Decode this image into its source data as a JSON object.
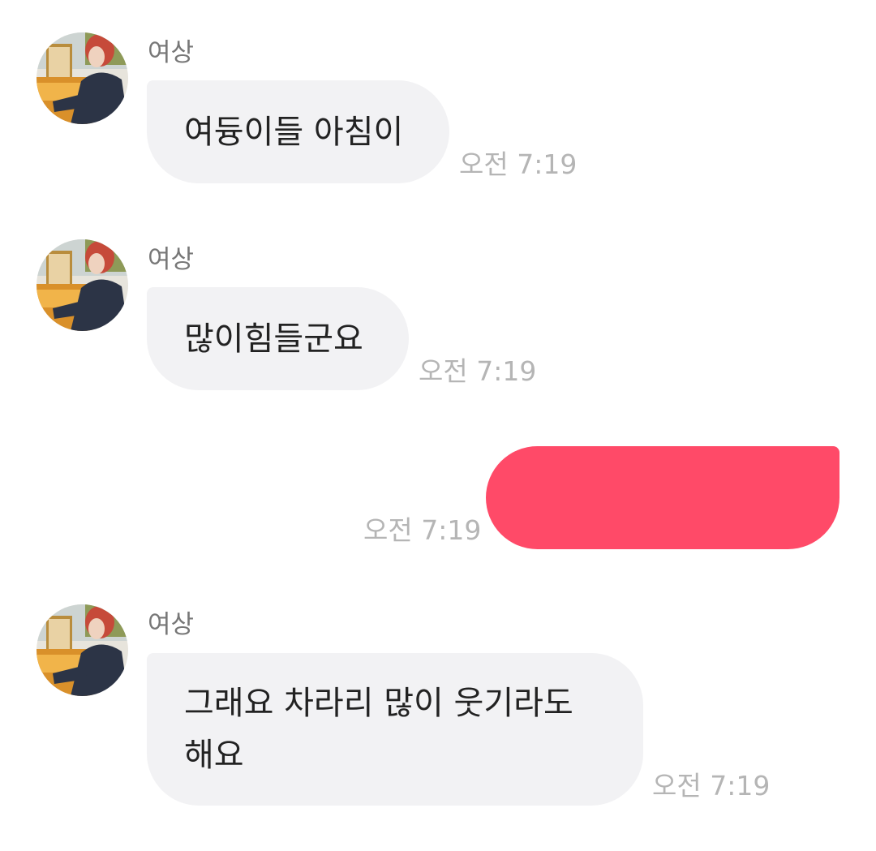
{
  "chat": {
    "messages": [
      {
        "direction": "incoming",
        "sender": "여상",
        "text": "여듕이들 아침이",
        "time": "오전 7:19"
      },
      {
        "direction": "incoming",
        "sender": "여상",
        "text": "많이힘들군요",
        "time": "오전 7:19"
      },
      {
        "direction": "outgoing",
        "text": "",
        "time": "오전 7:19"
      },
      {
        "direction": "incoming",
        "sender": "여상",
        "text": "그래요 차라리 많이 웃기라도 해요",
        "time": "오전 7:19"
      }
    ]
  },
  "colors": {
    "incoming_bubble": "#f2f2f4",
    "outgoing_bubble": "#ff4a68",
    "timestamp": "#b5b5b5",
    "sender_name": "#777777"
  }
}
